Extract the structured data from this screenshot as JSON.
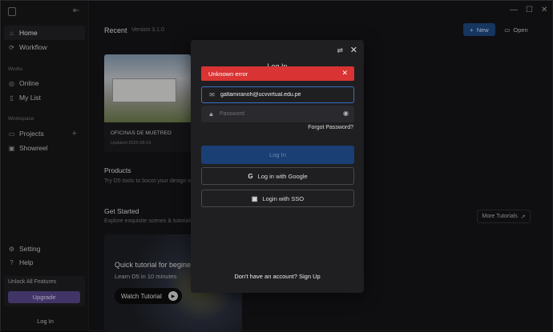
{
  "sidebar": {
    "nav_main": [
      {
        "label": "Home",
        "icon": "home-icon"
      },
      {
        "label": "Workflow",
        "icon": "workflow-icon"
      }
    ],
    "works_heading": "Works",
    "works_items": [
      {
        "label": "Online",
        "icon": "globe-icon"
      },
      {
        "label": "My List",
        "icon": "list-icon"
      }
    ],
    "workspace_heading": "Workspace",
    "workspace_items": [
      {
        "label": "Projects",
        "icon": "folder-icon"
      },
      {
        "label": "Showreel",
        "icon": "film-icon"
      }
    ],
    "bottom_items": [
      {
        "label": "Setting",
        "icon": "gear-icon"
      },
      {
        "label": "Help",
        "icon": "help-icon"
      }
    ],
    "unlock_text": "Unlock All Features",
    "upgrade_label": "Upgrade",
    "login_label": "Log In"
  },
  "main": {
    "recent_title": "Recent",
    "version": "Version 3.1.0",
    "new_label": "New",
    "open_label": "Open",
    "project_card": {
      "title": "OFICINAS DE MUETREO",
      "updated": "Updated 2025-08-03"
    },
    "products_title": "Products",
    "products_subtitle": "Try D5 tools to boost your design e",
    "started_title": "Get Started",
    "started_subtitle": "Explore exquisite scenes & tutorials",
    "tutorial": {
      "title": "Quick tutorial for begine",
      "subtitle": "Learn D5 in 10 minutes",
      "watch_label": "Watch Tutorial"
    },
    "more_tutorials_label": "More Tutorials"
  },
  "login_modal": {
    "heading": "Log In",
    "error_message": "Unknown error",
    "email_value": "galtamiranoh@ucvvirtual.edu.pe",
    "password_placeholder": "Password",
    "forgot_password": "Forgot Password?",
    "login_button": "Log In",
    "google_button": "Log in with Google",
    "sso_button": "Login with SSO",
    "signup_text": "Don't have an account? Sign Up"
  },
  "colors": {
    "accent_blue": "#1f4a86",
    "error_red": "#d93333",
    "upgrade_purple": "#5b4a8f"
  }
}
